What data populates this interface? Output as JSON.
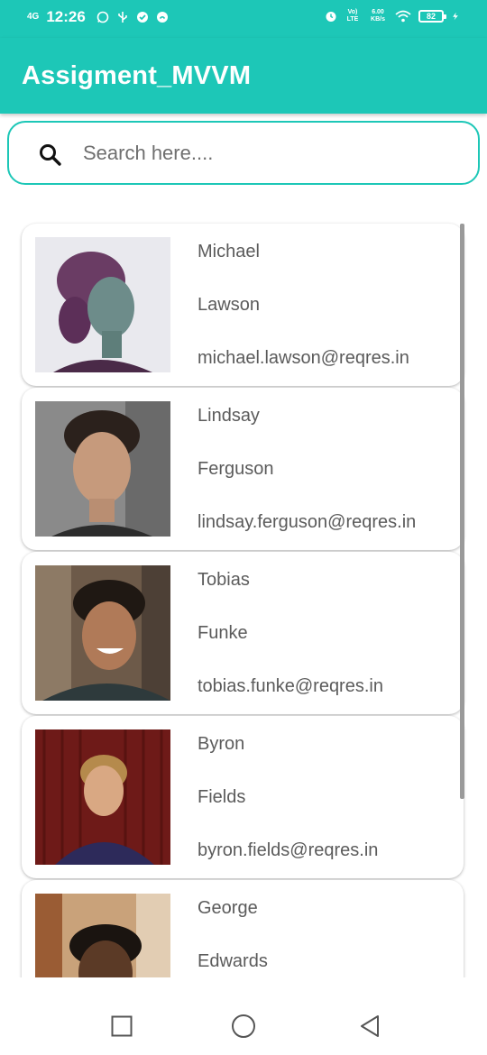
{
  "status_bar": {
    "network": "4G",
    "time": "12:26",
    "volte": "Vo) LTE",
    "speed": "6.00 KB/s",
    "battery": "82"
  },
  "app_bar": {
    "title": "Assigment_MVVM"
  },
  "search": {
    "placeholder": "Search here....",
    "value": ""
  },
  "users": [
    {
      "first_name": "Michael",
      "last_name": "Lawson",
      "email": "michael.lawson@reqres.in"
    },
    {
      "first_name": "Lindsay",
      "last_name": "Ferguson",
      "email": "lindsay.ferguson@reqres.in"
    },
    {
      "first_name": "Tobias",
      "last_name": "Funke",
      "email": "tobias.funke@reqres.in"
    },
    {
      "first_name": "Byron",
      "last_name": "Fields",
      "email": "byron.fields@reqres.in"
    },
    {
      "first_name": "George",
      "last_name": "Edwards",
      "email": ""
    }
  ],
  "nav_bar": {
    "recents_icon": "square-icon",
    "home_icon": "circle-icon",
    "back_icon": "triangle-back-icon"
  },
  "colors": {
    "accent": "#1dc7b7",
    "text": "#5b5b5b"
  }
}
